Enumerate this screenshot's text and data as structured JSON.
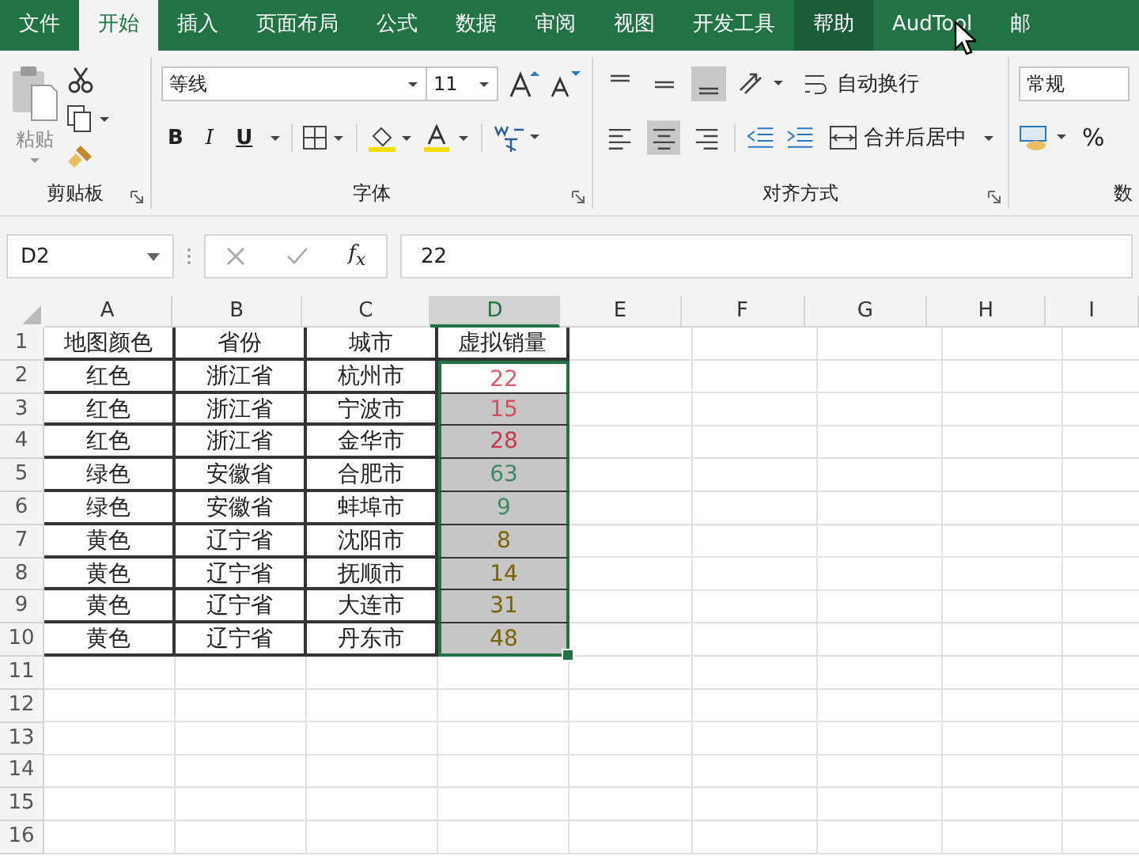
{
  "tabs": [
    {
      "label": "文件",
      "selected": false,
      "hovered": false
    },
    {
      "label": "开始",
      "selected": true,
      "hovered": false
    },
    {
      "label": "插入",
      "selected": false,
      "hovered": false
    },
    {
      "label": "页面布局",
      "selected": false,
      "hovered": false
    },
    {
      "label": "公式",
      "selected": false,
      "hovered": false
    },
    {
      "label": "数据",
      "selected": false,
      "hovered": false
    },
    {
      "label": "审阅",
      "selected": false,
      "hovered": false
    },
    {
      "label": "视图",
      "selected": false,
      "hovered": false
    },
    {
      "label": "开发工具",
      "selected": false,
      "hovered": false
    },
    {
      "label": "帮助",
      "selected": false,
      "hovered": true
    },
    {
      "label": "AudTool",
      "selected": false,
      "hovered": false
    },
    {
      "label": "邮",
      "selected": false,
      "hovered": false
    }
  ],
  "clipboard": {
    "paste_label": "粘贴",
    "group_label": "剪贴板"
  },
  "font": {
    "font_name": "等线",
    "font_size": "11",
    "bold": "B",
    "italic": "I",
    "underline": "U",
    "group_label": "字体"
  },
  "alignment": {
    "vertical": [
      {
        "kind": "top",
        "selected": false
      },
      {
        "kind": "middle",
        "selected": false
      },
      {
        "kind": "bottom",
        "selected": true
      }
    ],
    "horizontal": [
      {
        "kind": "left",
        "selected": false
      },
      {
        "kind": "center",
        "selected": true
      },
      {
        "kind": "right",
        "selected": false
      }
    ],
    "wrap_text": "自动换行",
    "merge_center": "合并后居中",
    "group_label": "对齐方式"
  },
  "number": {
    "format": "常规",
    "percent": "%",
    "group_label": "数"
  },
  "formula_bar": {
    "name_box": "D2",
    "function_button": "f$_{x}$",
    "value": "22"
  },
  "columns": [
    {
      "label": "A",
      "selected": false
    },
    {
      "label": "B",
      "selected": false
    },
    {
      "label": "C",
      "selected": false
    },
    {
      "label": "D",
      "selected": true
    },
    {
      "label": "E",
      "selected": false
    },
    {
      "label": "F",
      "selected": false
    },
    {
      "label": "G",
      "selected": false
    },
    {
      "label": "H",
      "selected": false
    },
    {
      "label": "I",
      "selected": false
    }
  ],
  "rows": [
    {
      "num": "1",
      "cells": [
        "地图颜色",
        "省份",
        "城市",
        "虚拟销量"
      ]
    },
    {
      "num": "2",
      "cells": [
        "红色",
        "浙江省",
        "杭州市"
      ],
      "value": {
        "text": "22",
        "color": "#e05a6e",
        "highlighted": false
      }
    },
    {
      "num": "3",
      "cells": [
        "红色",
        "浙江省",
        "宁波市"
      ],
      "value": {
        "text": "15",
        "color": "#d64a5e",
        "highlighted": true
      }
    },
    {
      "num": "4",
      "cells": [
        "红色",
        "浙江省",
        "金华市"
      ],
      "value": {
        "text": "28",
        "color": "#c8344a",
        "highlighted": true
      }
    },
    {
      "num": "5",
      "cells": [
        "绿色",
        "安徽省",
        "合肥市"
      ],
      "value": {
        "text": "63",
        "color": "#3e8a60",
        "highlighted": true
      }
    },
    {
      "num": "6",
      "cells": [
        "绿色",
        "安徽省",
        "蚌埠市"
      ],
      "value": {
        "text": "9",
        "color": "#3e8a60",
        "highlighted": true
      }
    },
    {
      "num": "7",
      "cells": [
        "黄色",
        "辽宁省",
        "沈阳市"
      ],
      "value": {
        "text": "8",
        "color": "#7a6200",
        "highlighted": true
      }
    },
    {
      "num": "8",
      "cells": [
        "黄色",
        "辽宁省",
        "抚顺市"
      ],
      "value": {
        "text": "14",
        "color": "#7a6200",
        "highlighted": true
      }
    },
    {
      "num": "9",
      "cells": [
        "黄色",
        "辽宁省",
        "大连市"
      ],
      "value": {
        "text": "31",
        "color": "#7a6200",
        "highlighted": true
      }
    },
    {
      "num": "10",
      "cells": [
        "黄色",
        "辽宁省",
        "丹东市"
      ],
      "value": {
        "text": "48",
        "color": "#7a6200",
        "highlighted": true
      }
    },
    {
      "num": "11",
      "cells": []
    },
    {
      "num": "12",
      "cells": []
    },
    {
      "num": "13",
      "cells": []
    },
    {
      "num": "14",
      "cells": []
    },
    {
      "num": "15",
      "cells": []
    },
    {
      "num": "16",
      "cells": []
    }
  ]
}
